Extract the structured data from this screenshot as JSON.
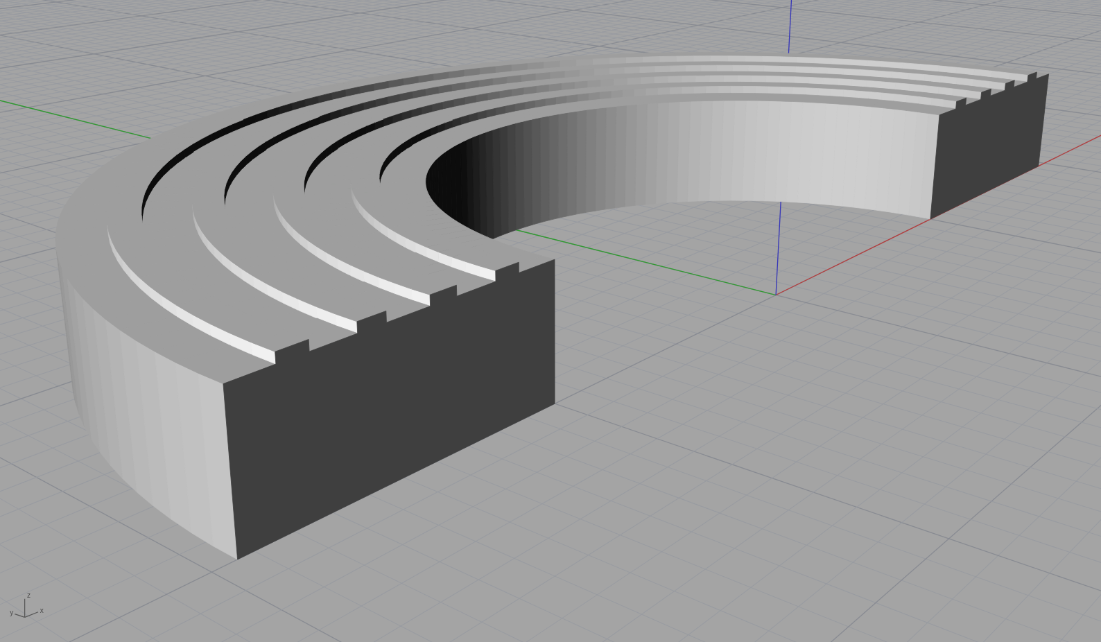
{
  "viewport": {
    "axis_icon": {
      "z_label": "z",
      "y_label": "y",
      "x_label": "x"
    }
  }
}
